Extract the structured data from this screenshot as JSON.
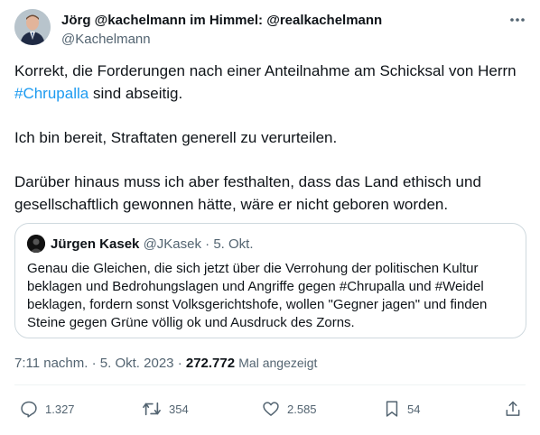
{
  "author": {
    "name": "Jörg @kachelmann im Himmel: @realkachelmann",
    "handle": "@Kachelmann"
  },
  "more_icon": "more-dots-icon",
  "tweet": {
    "line1_before": "Korrekt, die Forderungen nach einer Anteilnahme am Schicksal von Herrn ",
    "hashtag": "#Chrupalla",
    "line1_after": " sind abseitig.",
    "paragraph2": "Ich bin bereit, Straftaten generell zu verurteilen.",
    "paragraph3": "Darüber hinaus muss ich aber festhalten, dass das Land ethisch und gesellschaftlich gewonnen hätte, wäre er nicht geboren worden."
  },
  "quote": {
    "name": "Jürgen Kasek",
    "handle": "@JKasek",
    "separator": "·",
    "date": "5. Okt.",
    "text": "Genau die Gleichen, die sich jetzt über die Verrohung der politischen Kultur beklagen und Bedrohungslagen und Angriffe gegen #Chrupalla und #Weidel beklagen, fordern sonst Volksgerichtshofe, wollen \"Gegner jagen\" und finden Steine gegen Grüne völlig ok und Ausdruck des Zorns."
  },
  "meta": {
    "time": "7:11 nachm.",
    "separator": "·",
    "date": "5. Okt. 2023",
    "views": "272.772",
    "views_label": "Mal angezeigt"
  },
  "actions": {
    "replies": "1.327",
    "retweets": "354",
    "likes": "2.585",
    "bookmarks": "54"
  },
  "colors": {
    "link": "#1d9bf0",
    "secondary_text": "#536471",
    "primary_text": "#0f1419",
    "border": "#cfd9de"
  }
}
